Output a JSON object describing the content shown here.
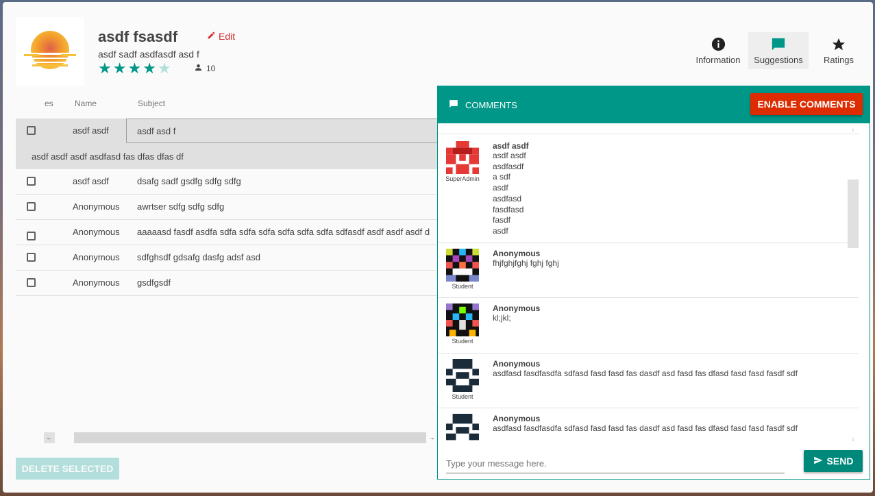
{
  "header": {
    "title": "asdf fsasdf",
    "edit_label": "Edit",
    "subtitle": "asdf sadf asdfasdf asd f",
    "rating": 4,
    "rating_max": 5,
    "participant_count": "10",
    "accent_color": "#009688"
  },
  "tabs": [
    {
      "label": "Information",
      "icon": "info-icon"
    },
    {
      "label": "Suggestions",
      "icon": "chat-icon",
      "active": true
    },
    {
      "label": "Ratings",
      "icon": "star-icon"
    }
  ],
  "table": {
    "headers": {
      "checkbox": "es",
      "name": "Name",
      "subject": "Subject"
    },
    "rows": [
      {
        "name": "asdf asdf",
        "subject": "asdf asd f",
        "selected": true
      },
      {
        "name": "asdf asdf",
        "subject": "dsafg sadf gsdfg sdfg sdfg"
      },
      {
        "name": "Anonymous",
        "subject": "awrtser sdfg sdfg sdfg"
      },
      {
        "name": "Anonymous",
        "subject": "aaaaasd fasdf asdfa sdfa sdfa sdfa sdfa sdfa sdfa sdfasdf asdf asdf asdf d"
      },
      {
        "name": "Anonymous",
        "subject": "sdfghsdf gdsafg dasfg adsf asd"
      },
      {
        "name": "Anonymous",
        "subject": "gsdfgsdf"
      }
    ],
    "selected_detail": "asdf asdf asdf asdfasd fas dfas dfas df",
    "delete_label": "DELETE SELECTED"
  },
  "comments": {
    "title": "COMMENTS",
    "enable_label": "ENABLE COMMENTS",
    "items": [
      {
        "author": "asdf asdf",
        "role": "SuperAdmin",
        "text": " asdf asdf\nasdfasdf\na sdf\nasdf\nasdfasd\nfasdfasd\nfasdf\nasdf"
      },
      {
        "author": "Anonymous",
        "role": "Student",
        "text": "fhjfghjfghj fghj fghj"
      },
      {
        "author": "Anonymous",
        "role": "Student",
        "text": "kl;jkl;"
      },
      {
        "author": "Anonymous",
        "role": "Student",
        "text": "asdfasd fasdfasdfa sdfasd fasd fasd fas dasdf asd fasd fas dfasd fasd fasd fasdf sdf"
      },
      {
        "author": "Anonymous",
        "role": "",
        "text": "asdfasd fasdfasdfa sdfasd fasd fasd fas dasdf asd fasd fas dfasd fasd fasd fasdf sdf"
      }
    ],
    "input_placeholder": "Type your message here.",
    "send_label": "SEND"
  }
}
